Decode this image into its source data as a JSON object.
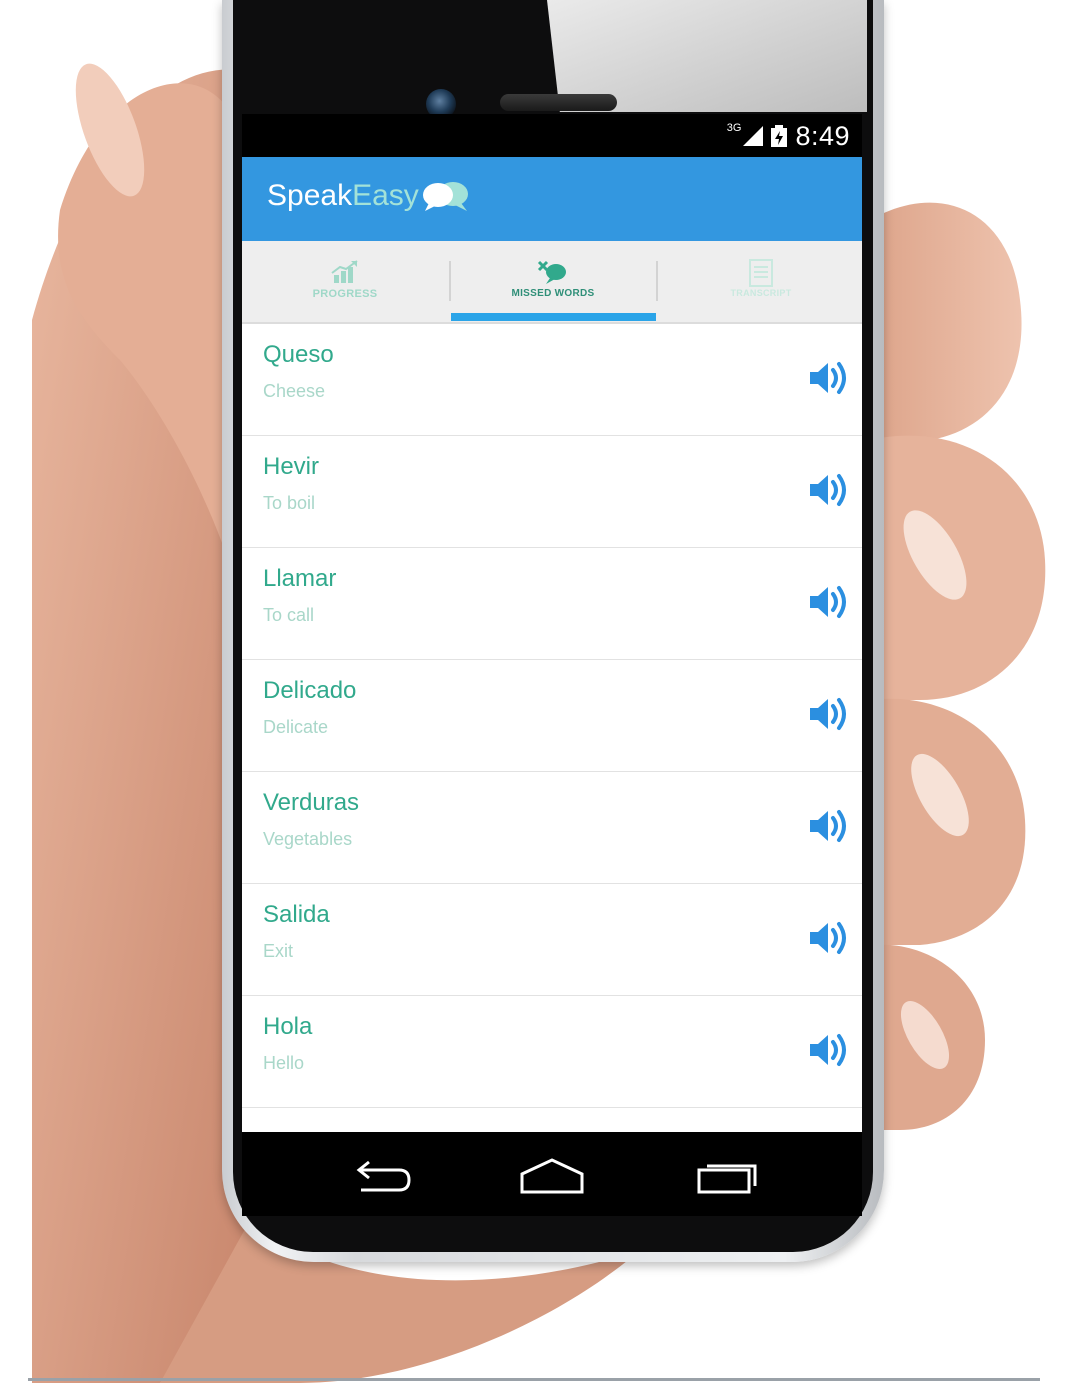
{
  "status_bar": {
    "network": "3G",
    "time": "8:49"
  },
  "app": {
    "name_part1": "Speak",
    "name_part2": "Easy"
  },
  "tabs": [
    {
      "label": "PROGRESS",
      "icon": "chart-icon",
      "active": false
    },
    {
      "label": "MISSED WORDS",
      "icon": "missed-words-icon",
      "active": true
    },
    {
      "label": "TRANSCRIPT",
      "icon": "transcript-icon",
      "active": false
    }
  ],
  "words": [
    {
      "word": "Queso",
      "meaning": "Cheese"
    },
    {
      "word": "Hevir",
      "meaning": "To boil"
    },
    {
      "word": "Llamar",
      "meaning": "To call"
    },
    {
      "word": "Delicado",
      "meaning": "Delicate"
    },
    {
      "word": "Verduras",
      "meaning": "Vegetables"
    },
    {
      "word": "Salida",
      "meaning": "Exit"
    },
    {
      "word": "Hola",
      "meaning": "Hello"
    }
  ],
  "nav": {
    "back_icon": "back-icon",
    "home_icon": "home-icon",
    "recents_icon": "recents-icon"
  },
  "colors": {
    "app_bar": "#3397e0",
    "word": "#31a98c",
    "meaning": "#a9d7c9",
    "accent": "#2aa4e8",
    "speaker_icon": "#2b8fe0"
  }
}
